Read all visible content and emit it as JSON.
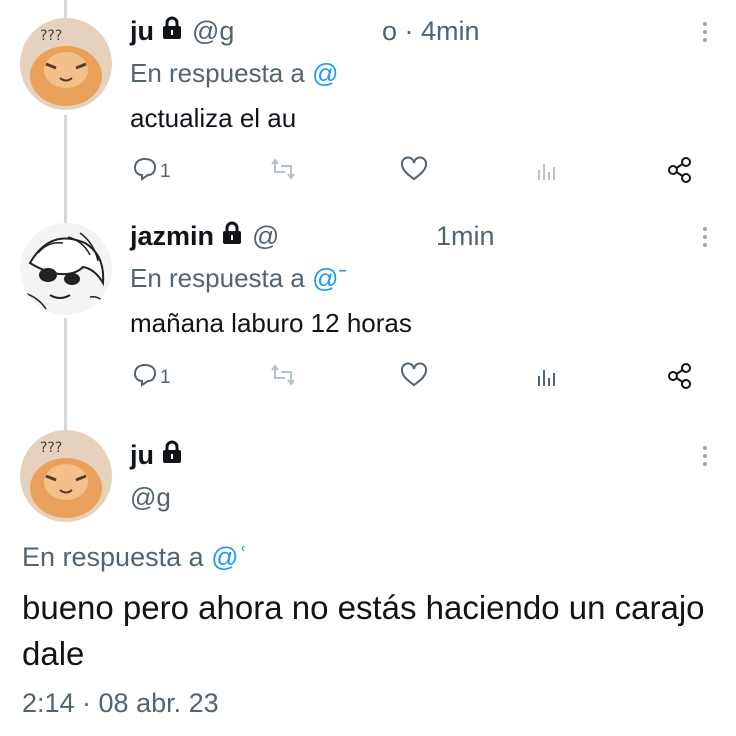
{
  "tweets": [
    {
      "name": "ju",
      "handle": "@ɡ",
      "time": "o · 4min",
      "reply_label": "En respuesta a ",
      "reply_mention": "@",
      "text": "actualiza el au",
      "replies": "1",
      "avatar": "cat-avatar"
    },
    {
      "name": "jazmin",
      "handle": "@",
      "time": "1min",
      "reply_label": "En respuesta a ",
      "reply_mention": "@ˉ",
      "text": "mañana laburo 12 horas",
      "replies": "1",
      "avatar": "anime-avatar"
    }
  ],
  "main": {
    "name": "ju",
    "handle": "@ɡ",
    "reply_label": "En respuesta a ",
    "reply_mention": "@ʿ",
    "text": "bueno pero ahora no estás haciendo un carajo dale",
    "timestamp": "2:14 · 08 abr. 23",
    "avatar": "cat-avatar"
  },
  "colors": {
    "accent": "#1d9bf0",
    "secondary_text": "#536471",
    "primary_text": "#0f1419",
    "thread_line": "#cfd9de"
  }
}
